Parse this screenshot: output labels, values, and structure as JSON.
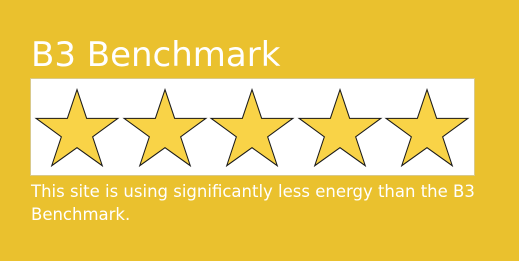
{
  "card": {
    "title": "B3 Benchmark",
    "description": "This site is using significantly less energy than the B3 Benchmark.",
    "background_color": "#eac12e",
    "text_color": "#ffffff"
  },
  "rating": {
    "value": 5,
    "max": 5,
    "star_fill_color": "#f9d347",
    "star_outline_color": "#1a1a1a"
  }
}
